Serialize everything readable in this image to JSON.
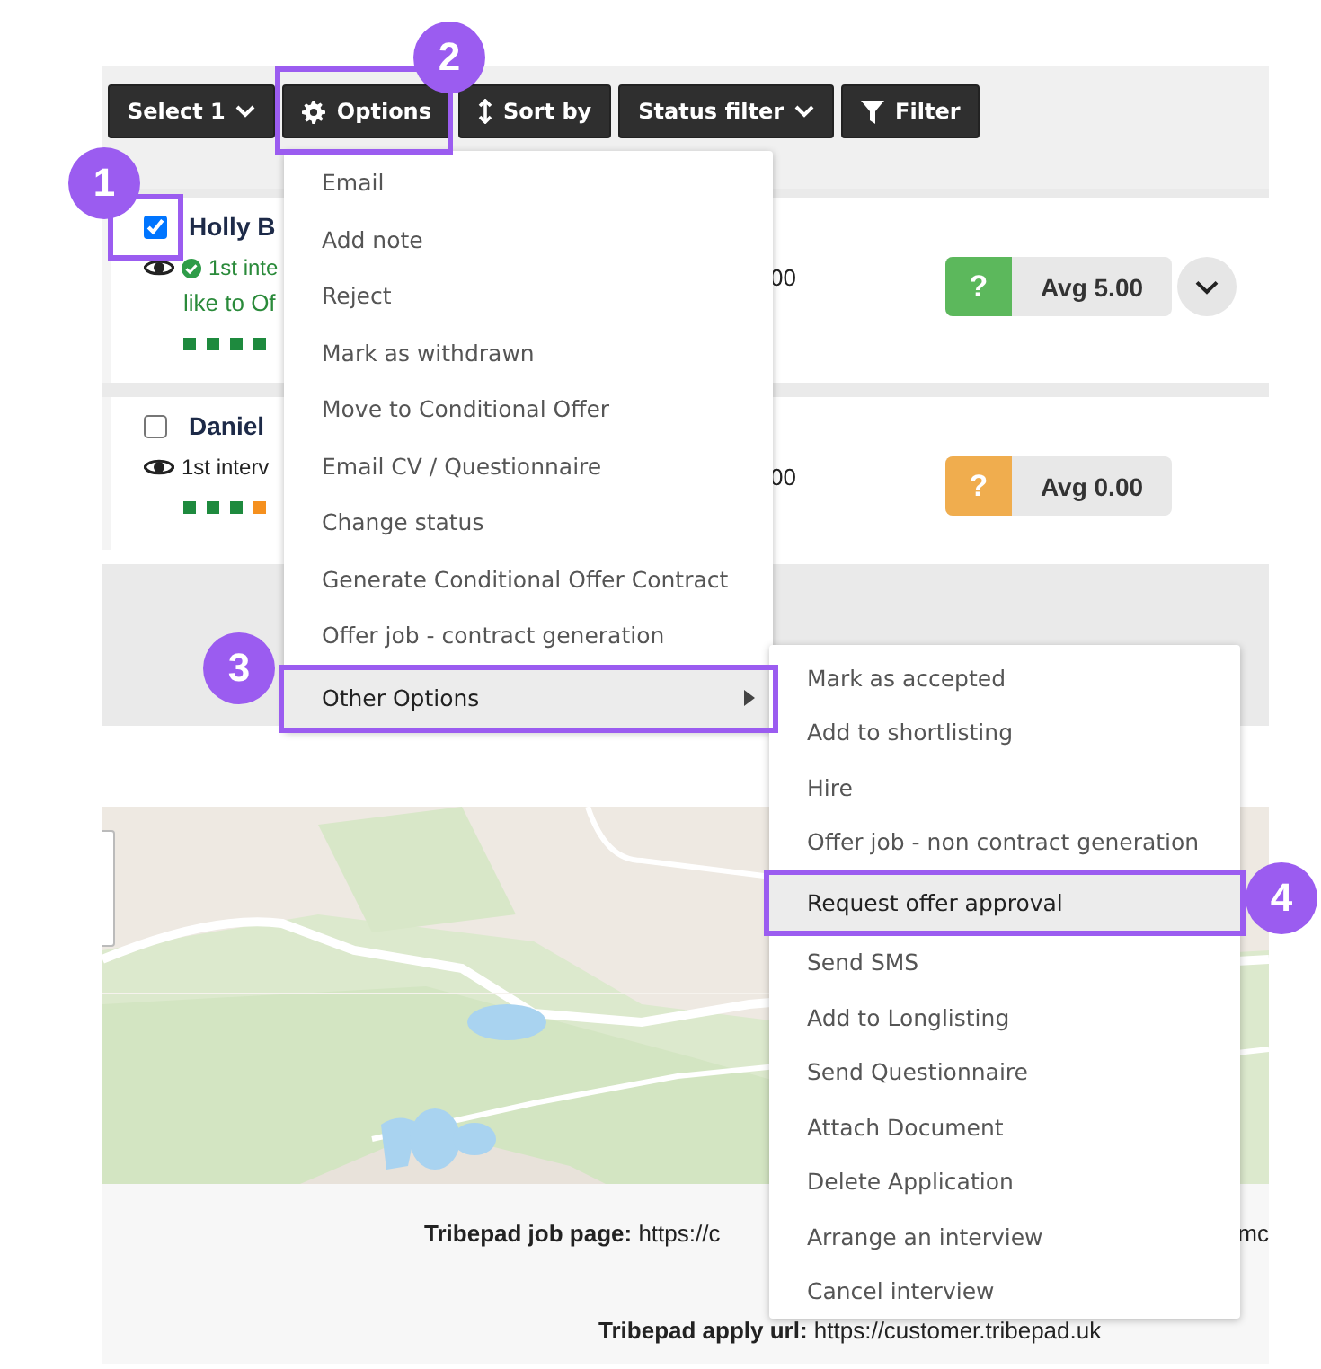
{
  "toolbar": {
    "buttons": [
      {
        "label": "Select 1",
        "kind": "dropdown"
      },
      {
        "label": "Options",
        "kind": "gear"
      },
      {
        "label": "Sort by",
        "kind": "sort"
      },
      {
        "label": "Status filter",
        "kind": "dropdown"
      },
      {
        "label": "Filter",
        "kind": "filter"
      }
    ]
  },
  "candidates": [
    {
      "name": "Holly B",
      "checked": true,
      "stage_done": true,
      "stage": "1st inte",
      "stage_note": "like to Of",
      "tail": "00",
      "score_mark": "?",
      "color": "#5cb85c",
      "score": "Avg 5.00",
      "expandable": true,
      "progress": [
        {
          "color": "#1e8a3e"
        },
        {
          "color": "#1e8a3e"
        },
        {
          "color": "#1e8a3e"
        },
        {
          "color": "#1e8a3e"
        }
      ]
    },
    {
      "name": "Daniel",
      "checked": false,
      "stage_done": false,
      "stage": "1st interv",
      "tail": "00",
      "score_mark": "?",
      "color": "#f0ad4e",
      "score": "Avg 0.00",
      "expandable": false,
      "progress": [
        {
          "color": "#1e8a3e"
        },
        {
          "color": "#1e8a3e"
        },
        {
          "color": "#1e8a3e"
        },
        {
          "color": "#f5901e"
        }
      ]
    }
  ],
  "footer": {
    "job_page": "**Tribepad job page:** https://c",
    "job_page_tail": "mc",
    "apply_url": "**Tribepad apply url:** https://customer.tribepad.uk"
  },
  "options_menu": {
    "items": [
      {
        "label": "Email",
        "selected": false,
        "submenu": false
      },
      {
        "label": "Add note",
        "selected": false,
        "submenu": false
      },
      {
        "label": "Reject",
        "selected": false,
        "submenu": false
      },
      {
        "label": "Mark as withdrawn",
        "selected": false,
        "submenu": false
      },
      {
        "label": "Move to Conditional Offer",
        "selected": false,
        "submenu": false
      },
      {
        "label": "Email CV / Questionnaire",
        "selected": false,
        "submenu": false
      },
      {
        "label": "Change status",
        "selected": false,
        "submenu": false
      },
      {
        "label": "Generate Conditional Offer Contract",
        "selected": false,
        "submenu": false
      },
      {
        "label": "Offer job - contract generation",
        "selected": false,
        "submenu": false
      },
      {
        "label": "Other Options",
        "selected": true,
        "submenu": true
      }
    ]
  },
  "other_options_menu": {
    "items": [
      {
        "label": "Mark as accepted",
        "selected": false
      },
      {
        "label": "Add to shortlisting",
        "selected": false
      },
      {
        "label": "Hire",
        "selected": false
      },
      {
        "label": "Offer job - non contract generation",
        "selected": false
      },
      {
        "label": "Request offer approval",
        "selected": true
      },
      {
        "label": "Send SMS",
        "selected": false
      },
      {
        "label": "Add to Longlisting",
        "selected": false
      },
      {
        "label": "Send Questionnaire",
        "selected": false
      },
      {
        "label": "Attach Document",
        "selected": false
      },
      {
        "label": "Delete Application",
        "selected": false
      },
      {
        "label": "Arrange an interview",
        "selected": false
      },
      {
        "label": "Cancel interview",
        "selected": false
      }
    ]
  },
  "callouts": [
    {
      "number": "1"
    },
    {
      "number": "2"
    },
    {
      "number": "3"
    },
    {
      "number": "4"
    }
  ]
}
